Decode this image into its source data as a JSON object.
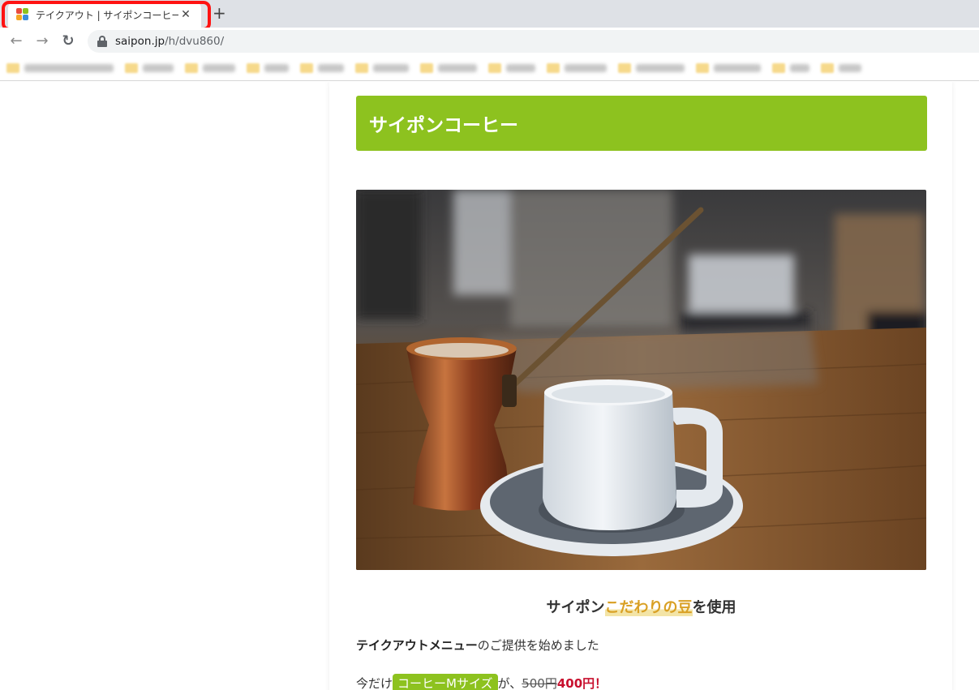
{
  "browser": {
    "tab_title": "テイクアウト | サイポンコーヒー",
    "close_glyph": "✕",
    "newtab_glyph": "+",
    "url_host": "saipon.jp",
    "url_path": "/h/dvu860/",
    "back_glyph": "←",
    "forward_glyph": "→",
    "reload_glyph": "↻",
    "highlight_color": "#ff1212"
  },
  "page": {
    "site_title": "サイポンコーヒー",
    "header_color": "#8dc21f",
    "headline_prefix": "サイポン",
    "headline_accent": "こだわりの豆",
    "headline_suffix": "を使用",
    "intro_bold": "テイクアウトメニュー",
    "intro_rest": "のご提供を始めました",
    "offer_prefix": "今だけ",
    "offer_badge": "コーヒーMサイズ",
    "offer_mid": "が、",
    "old_price": "500円",
    "new_price": "400円！"
  }
}
